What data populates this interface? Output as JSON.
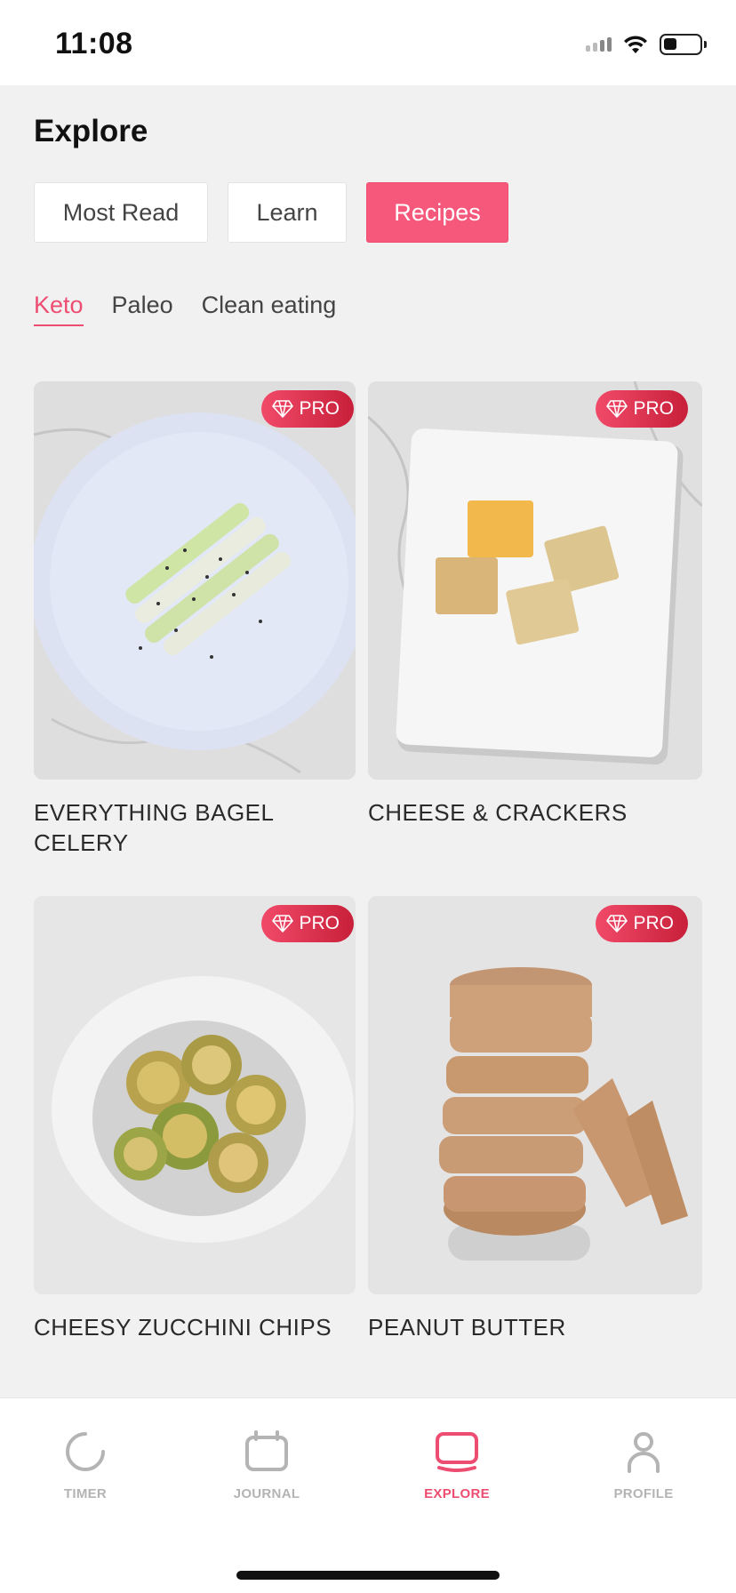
{
  "status_bar": {
    "time": "11:08"
  },
  "header": {
    "title": "Explore"
  },
  "segment_tabs": [
    {
      "label": "Most Read",
      "active": false
    },
    {
      "label": "Learn",
      "active": false
    },
    {
      "label": "Recipes",
      "active": true
    }
  ],
  "sub_tabs": [
    {
      "label": "Keto",
      "active": true
    },
    {
      "label": "Paleo",
      "active": false
    },
    {
      "label": "Clean eating",
      "active": false
    }
  ],
  "recipes": [
    {
      "title": "EVERYTHING BAGEL CELERY",
      "badge": "PRO"
    },
    {
      "title": "CHEESE & CRACKERS",
      "badge": "PRO"
    },
    {
      "title": "CHEESY ZUCCHINI CHIPS",
      "badge": "PRO"
    },
    {
      "title": "PEANUT BUTTER",
      "badge": "PRO"
    }
  ],
  "bottom_nav": [
    {
      "label": "TIMER",
      "icon": "timer-icon",
      "active": false
    },
    {
      "label": "JOURNAL",
      "icon": "calendar-icon",
      "active": false
    },
    {
      "label": "EXPLORE",
      "icon": "explore-icon",
      "active": true
    },
    {
      "label": "PROFILE",
      "icon": "profile-icon",
      "active": false
    }
  ],
  "colors": {
    "accent": "#f5587a",
    "badge": "#d62a44",
    "inactive": "#b4b4b4"
  }
}
